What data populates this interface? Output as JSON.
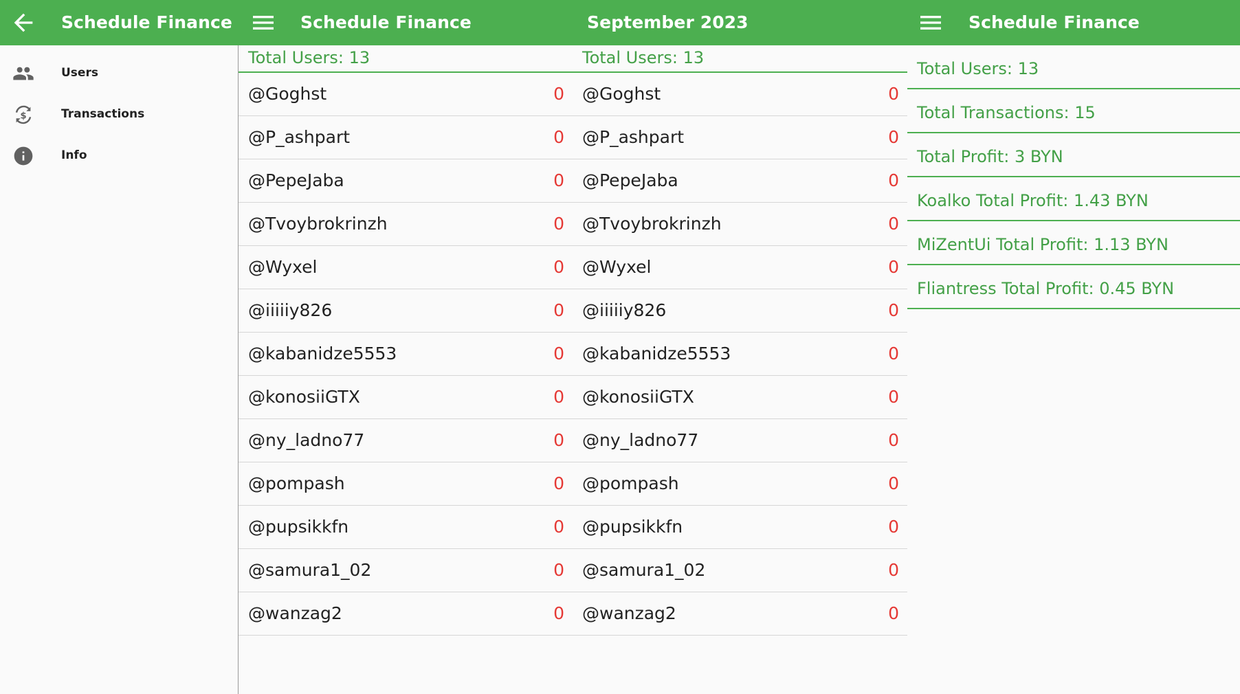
{
  "colors": {
    "primary": "#4caf50",
    "accent_text": "#43a047",
    "negative": "#e53935"
  },
  "drawer": {
    "title": "Schedule Finance",
    "back_icon": "arrow-left-icon",
    "items": [
      {
        "label": "Users",
        "icon": "users-icon"
      },
      {
        "label": "Transactions",
        "icon": "currency-exchange-icon"
      },
      {
        "label": "Info",
        "icon": "info-icon"
      }
    ]
  },
  "users_screen": {
    "title": "Schedule Finance",
    "menu_icon": "hamburger-menu-icon",
    "total_users": "Total Users: 13"
  },
  "monthly_screen": {
    "title": "September 2023",
    "total_users": "Total Users: 13"
  },
  "users": [
    {
      "name": "@Goghst",
      "value": "0"
    },
    {
      "name": "@P_ashpart",
      "value": "0"
    },
    {
      "name": "@PepeJaba",
      "value": "0"
    },
    {
      "name": "@Tvoybrokrinzh",
      "value": "0"
    },
    {
      "name": "@Wyxel",
      "value": "0"
    },
    {
      "name": "@iiiiiy826",
      "value": "0"
    },
    {
      "name": "@kabanidze5553",
      "value": "0"
    },
    {
      "name": "@konosiiGTX",
      "value": "0"
    },
    {
      "name": "@ny_ladno77",
      "value": "0"
    },
    {
      "name": "@pompash",
      "value": "0"
    },
    {
      "name": "@pupsikkfn",
      "value": "0"
    },
    {
      "name": "@samura1_02",
      "value": "0"
    },
    {
      "name": "@wanzag2",
      "value": "0"
    }
  ],
  "info_screen": {
    "title": "Schedule Finance",
    "menu_icon": "hamburger-menu-icon",
    "stats": [
      "Total Users: 13",
      "Total Transactions: 15",
      "Total Profit: 3 BYN",
      "Koalko Total Profit: 1.43 BYN",
      "MiZentUi Total Profit: 1.13 BYN",
      "Fliantress Total Profit: 0.45 BYN"
    ]
  }
}
